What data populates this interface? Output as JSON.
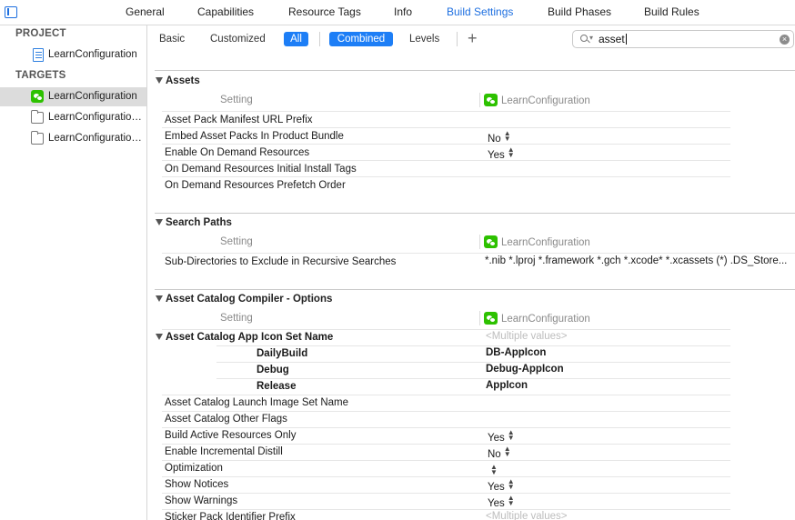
{
  "top_tabs": [
    {
      "label": "General",
      "active": false
    },
    {
      "label": "Capabilities",
      "active": false
    },
    {
      "label": "Resource Tags",
      "active": false
    },
    {
      "label": "Info",
      "active": false
    },
    {
      "label": "Build Settings",
      "active": true
    },
    {
      "label": "Build Phases",
      "active": false
    },
    {
      "label": "Build Rules",
      "active": false
    }
  ],
  "sidebar": {
    "project_header": "PROJECT",
    "project_item": "LearnConfiguration",
    "targets_header": "TARGETS",
    "targets": [
      {
        "label": "LearnConfiguration",
        "icon": "wechat-app-icon",
        "selected": true
      },
      {
        "label": "LearnConfigurationTests",
        "icon": "folder-icon",
        "selected": false
      },
      {
        "label": "LearnConfigurationUITests",
        "icon": "folder-icon",
        "selected": false
      }
    ]
  },
  "filter": {
    "basic": "Basic",
    "customized": "Customized",
    "all": "All",
    "combined": "Combined",
    "levels": "Levels",
    "add": "+",
    "search_value": "asset",
    "clear": "×"
  },
  "colors": {
    "accent": "#1d7ef6",
    "selection": "#dcdcdc",
    "app_icon": "#2dc100"
  },
  "sections": {
    "assets": {
      "title": "Assets",
      "setting_header": "Setting",
      "target_header": "LearnConfiguration",
      "rows": [
        {
          "name": "Asset Pack Manifest URL Prefix",
          "value": ""
        },
        {
          "name": "Embed Asset Packs In Product Bundle",
          "value": "No"
        },
        {
          "name": "Enable On Demand Resources",
          "value": "Yes"
        },
        {
          "name": "On Demand Resources Initial Install Tags",
          "value": ""
        },
        {
          "name": "On Demand Resources Prefetch Order",
          "value": ""
        }
      ]
    },
    "search_paths": {
      "title": "Search Paths",
      "setting_header": "Setting",
      "target_header": "LearnConfiguration",
      "rows": [
        {
          "name": "Sub-Directories to Exclude in Recursive Searches",
          "value": "*.nib *.lproj *.framework *.gch *.xcode* *.xcassets (*) .DS_Store..."
        }
      ]
    },
    "catalog": {
      "title": "Asset Catalog Compiler - Options",
      "setting_header": "Setting",
      "target_header": "LearnConfiguration",
      "icon_set": {
        "name": "Asset Catalog App Icon Set Name",
        "value": "<Multiple values>",
        "configs": [
          {
            "name": "DailyBuild",
            "value": "DB-AppIcon"
          },
          {
            "name": "Debug",
            "value": "Debug-AppIcon"
          },
          {
            "name": "Release",
            "value": "AppIcon"
          }
        ]
      },
      "rows": [
        {
          "name": "Asset Catalog Launch Image Set Name",
          "value": ""
        },
        {
          "name": "Asset Catalog Other Flags",
          "value": ""
        },
        {
          "name": "Build Active Resources Only",
          "value": "Yes"
        },
        {
          "name": "Enable Incremental Distill",
          "value": "No"
        },
        {
          "name": "Optimization",
          "value": ""
        },
        {
          "name": "Show Notices",
          "value": "Yes"
        },
        {
          "name": "Show Warnings",
          "value": "Yes"
        },
        {
          "name": "Sticker Pack Identifier Prefix",
          "value": "<Multiple values>"
        }
      ]
    }
  }
}
